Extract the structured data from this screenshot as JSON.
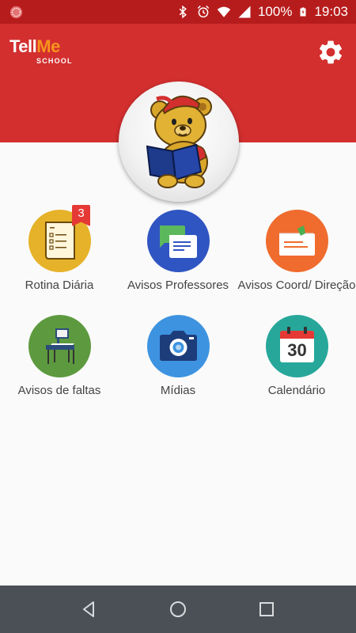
{
  "status_bar": {
    "battery": "100%",
    "time": "19:03",
    "icons": [
      "app-icon",
      "bluetooth-icon",
      "alarm-icon",
      "wifi-icon",
      "signal-icon",
      "battery-icon"
    ]
  },
  "header": {
    "logo_part1": "Tell",
    "logo_part2": "Me",
    "logo_sub": "SCHOOL",
    "bg_color": "#d32f2f",
    "settings_icon": "gear-icon"
  },
  "avatar": {
    "icon": "bear-reading-book"
  },
  "menu": [
    {
      "label": "Rotina Diária",
      "badge": "3",
      "color": "#e6b229",
      "icon": "checklist-icon"
    },
    {
      "label": "Avisos Professores",
      "color": "#2f55c2",
      "icon": "chat-bubbles-icon"
    },
    {
      "label": "Avisos Coord/ Direção",
      "color": "#ef6c2e",
      "icon": "notice-icon"
    },
    {
      "label": "Avisos de faltas",
      "color": "#5d9a3f",
      "icon": "school-desk-icon"
    },
    {
      "label": "Mídias",
      "color": "#3d93e0",
      "icon": "camera-icon"
    },
    {
      "label": "Calendário",
      "color": "#26a79a",
      "icon": "calendar-icon",
      "calendar_day": "30"
    }
  ],
  "navbar": {
    "icons": [
      "back-icon",
      "home-icon",
      "recents-icon"
    ]
  }
}
